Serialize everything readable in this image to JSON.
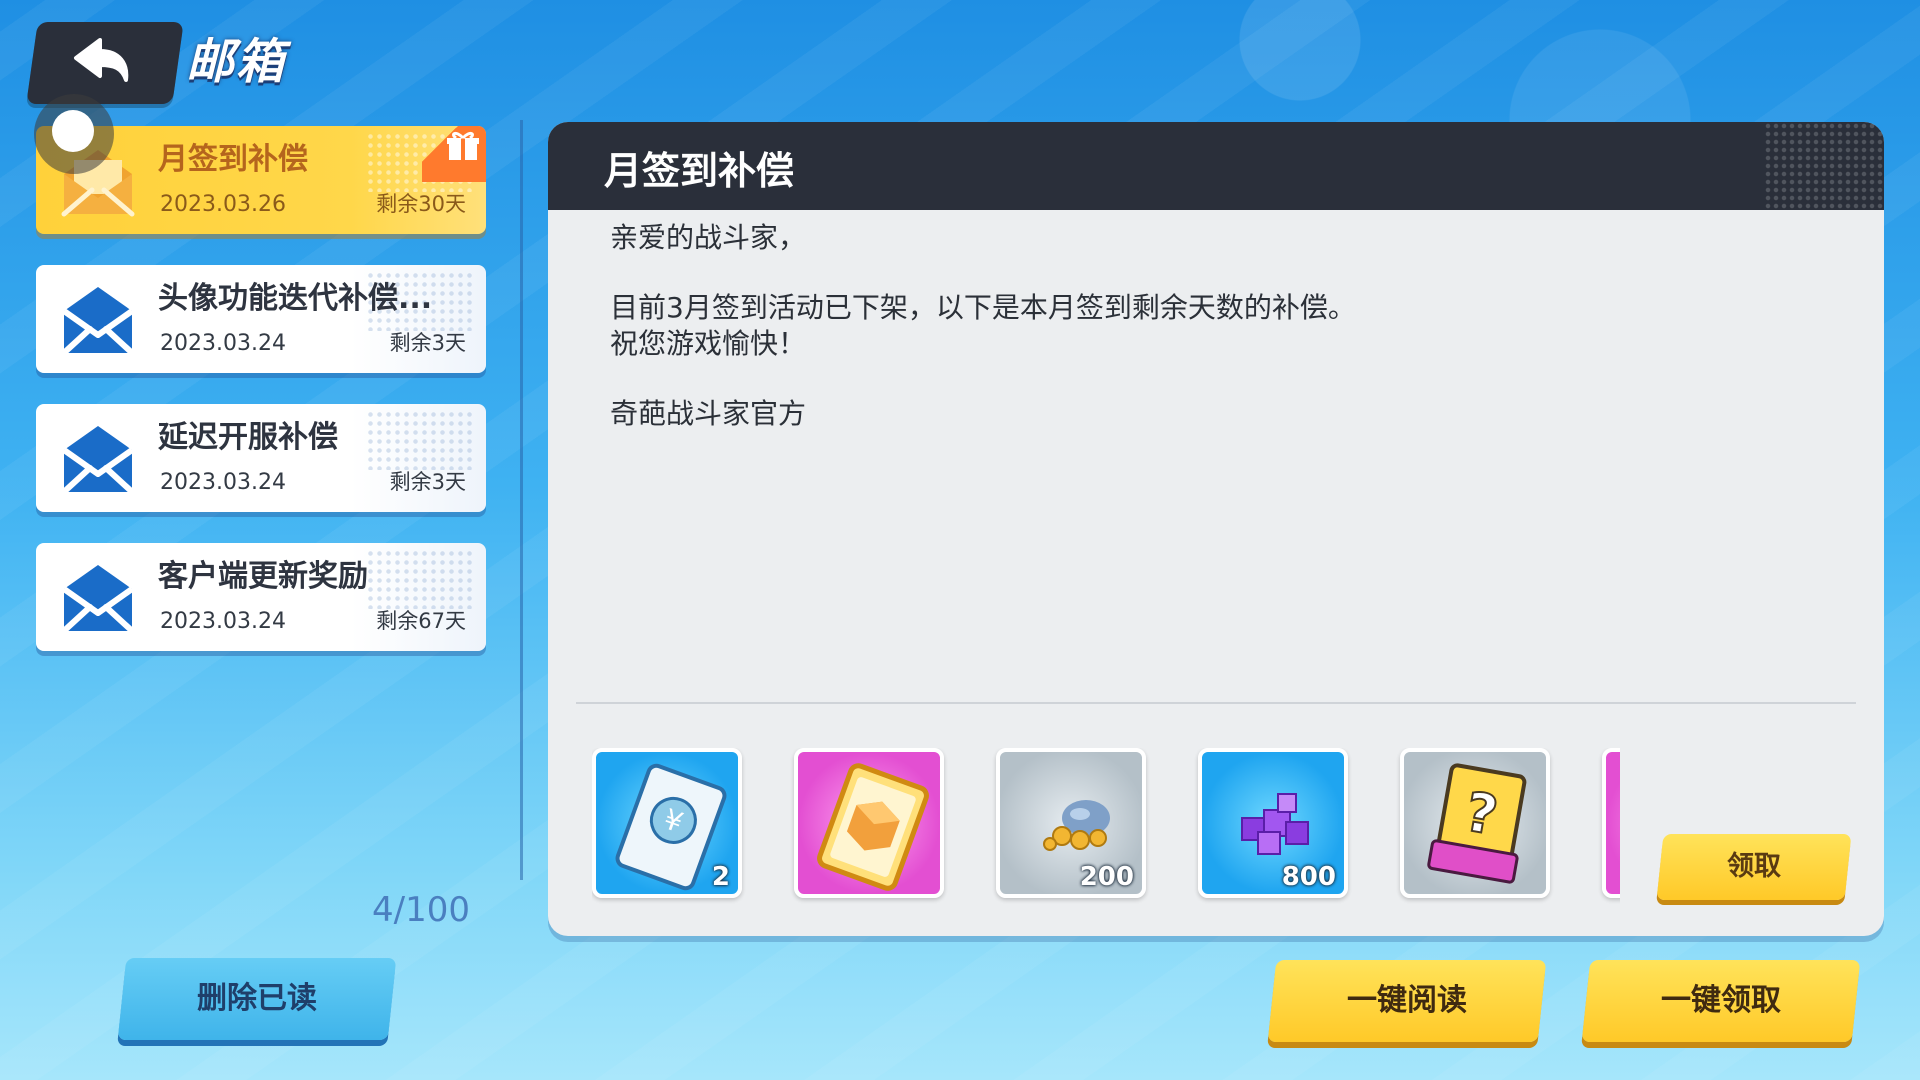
{
  "header": {
    "title": "邮箱"
  },
  "mails": [
    {
      "title": "月签到补偿",
      "date": "2023.03.26",
      "remain": "剩余30天",
      "selected": true
    },
    {
      "title": "头像功能迭代补偿...",
      "date": "2023.03.24",
      "remain": "剩余3天",
      "selected": false
    },
    {
      "title": "延迟开服补偿",
      "date": "2023.03.24",
      "remain": "剩余3天",
      "selected": false
    },
    {
      "title": "客户端更新奖励",
      "date": "2023.03.24",
      "remain": "剩余67天",
      "selected": false
    }
  ],
  "mail_count": "4/100",
  "buttons": {
    "delete_read": "删除已读",
    "claim": "领取",
    "read_all": "一键阅读",
    "claim_all": "一键领取"
  },
  "detail": {
    "title": "月签到补偿",
    "greeting": "亲爱的战斗家，",
    "line1": "目前3月签到活动已下架，以下是本月签到剩余天数的补偿。",
    "line2": "祝您游戏愉快！",
    "signature": "奇葩战斗家官方"
  },
  "rewards": [
    {
      "icon": "ticket-icon",
      "count": "2",
      "color": "blue"
    },
    {
      "icon": "crystal-ticket-icon",
      "count": "",
      "color": "pink"
    },
    {
      "icon": "coin-bag-icon",
      "count": "200",
      "color": "gray"
    },
    {
      "icon": "purple-cubes-icon",
      "count": "800",
      "color": "blue"
    },
    {
      "icon": "mystery-card-icon",
      "count": "",
      "color": "gray"
    },
    {
      "icon": "partial-item-icon",
      "count": "",
      "color": "pink"
    }
  ],
  "colors": {
    "accent_yellow": "#ffd13a",
    "header_dark": "#2a2f3a",
    "bg_blue": "#1f8fe3"
  }
}
